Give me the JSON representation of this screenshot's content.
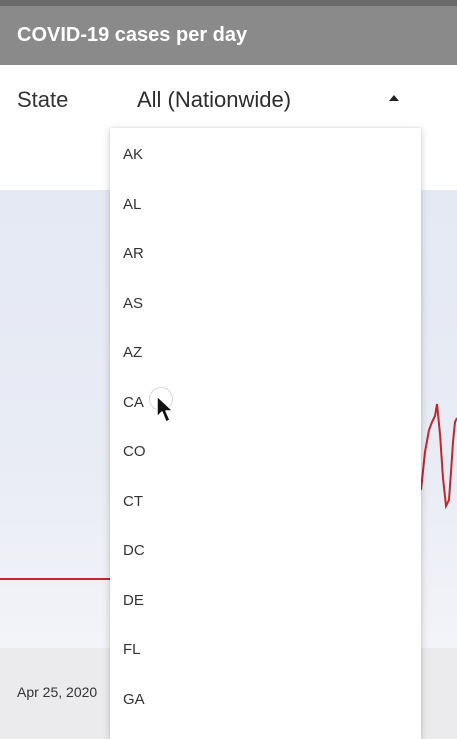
{
  "header": {
    "title": "COVID-19 cases per day"
  },
  "controls": {
    "state_label": "State",
    "selected_value": "All (Nationwide)",
    "arrow_icon": "arrow-up-icon"
  },
  "dropdown": {
    "options": [
      "AK",
      "AL",
      "AR",
      "AS",
      "AZ",
      "CA",
      "CO",
      "CT",
      "DC",
      "DE",
      "FL",
      "GA"
    ],
    "hovered": "CA"
  },
  "chart": {
    "x_tick": "Apr 25, 2020",
    "line_color": "#c1272d",
    "background": "#e7eaf4"
  },
  "cursor": {
    "icon": "mouse-pointer-icon"
  }
}
